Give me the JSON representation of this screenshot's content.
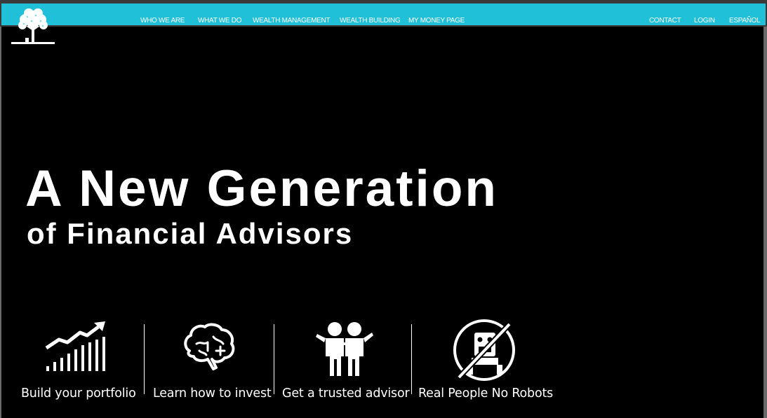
{
  "nav": {
    "left": [
      "WHO WE ARE",
      "WHAT WE DO",
      "WEALTH MANAGEMENT",
      "WEALTH BUILDING",
      "MY MONEY PAGE"
    ],
    "right": [
      "CONTACT",
      "LOGIN",
      "ESPAÑOL"
    ]
  },
  "hero": {
    "title": "A New Generation",
    "subtitle": "of Financial Advisors"
  },
  "features": [
    {
      "label": "Build your portfolio",
      "icon": "growth-chart-icon"
    },
    {
      "label": "Learn how to invest",
      "icon": "brain-icon"
    },
    {
      "label": "Get a trusted advisor",
      "icon": "people-icon"
    },
    {
      "label": "Real People No Robots",
      "icon": "no-robot-icon"
    }
  ],
  "colors": {
    "topbar": "#20c0d8",
    "background": "#000000",
    "text": "#ffffff"
  }
}
